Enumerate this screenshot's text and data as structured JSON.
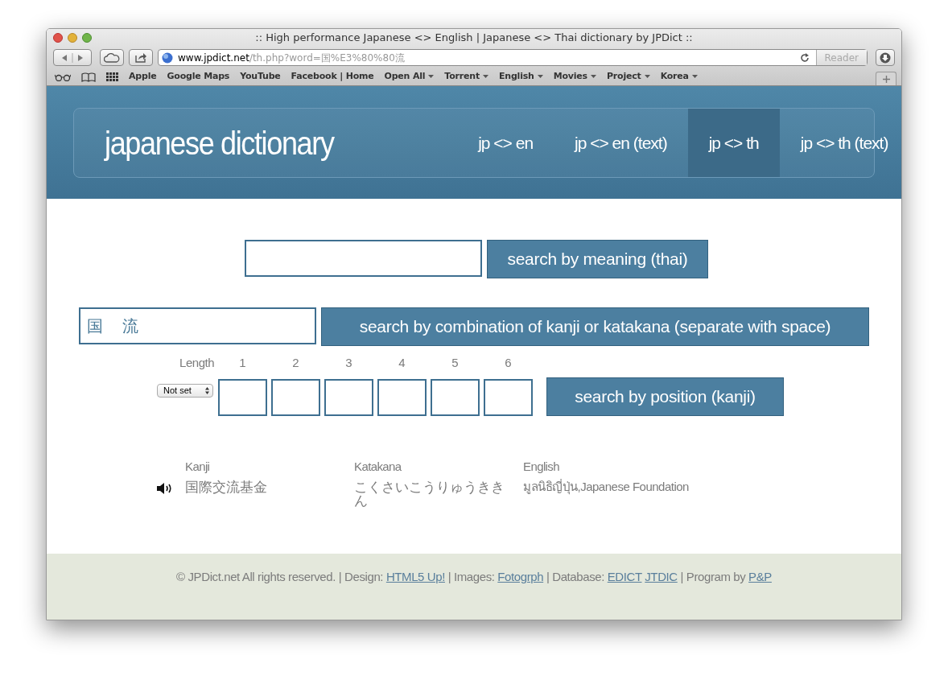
{
  "browser": {
    "title": ":: High performance Japanese <> English | Japanese <> Thai dictionary by JPDict ::",
    "url_host": "www.jpdict.net",
    "url_path": "/th.php?word=国%E3%80%80流",
    "reader": "Reader",
    "bookmarks": [
      {
        "label": "Apple",
        "menu": false
      },
      {
        "label": "Google Maps",
        "menu": false
      },
      {
        "label": "YouTube",
        "menu": false
      },
      {
        "label": "Facebook | Home",
        "menu": false
      },
      {
        "label": "Open All",
        "menu": true
      },
      {
        "label": "Torrent",
        "menu": true
      },
      {
        "label": "English",
        "menu": true
      },
      {
        "label": "Movies",
        "menu": true
      },
      {
        "label": "Project",
        "menu": true
      },
      {
        "label": "Korea",
        "menu": true
      }
    ]
  },
  "site": {
    "logo": "japanese dictionary",
    "nav": [
      {
        "label": "jp <> en",
        "selected": false
      },
      {
        "label": "jp <> en (text)",
        "selected": false
      },
      {
        "label": "jp <> th",
        "selected": true
      },
      {
        "label": "jp <> th (text)",
        "selected": false
      }
    ]
  },
  "meaning_search": {
    "button": "search by meaning (thai)"
  },
  "kanji_search": {
    "value": "国　流",
    "button": "search by combination of kanji or katakana (separate with space)"
  },
  "position_search": {
    "length_label": "Length",
    "length_select": "Not set",
    "positions": [
      "1",
      "2",
      "3",
      "4",
      "5",
      "6"
    ],
    "button": "search by position (kanji)"
  },
  "results": {
    "columns": [
      "Kanji",
      "Katakana",
      "English"
    ],
    "rows": [
      {
        "kanji": "国際交流基金",
        "katakana": "こくさいこうりゅうききん",
        "english": "มูลนิธิญี่ปุ่น,Japanese Foundation"
      }
    ]
  },
  "footer": [
    {
      "kind": "text",
      "text": "© JPDict.net All rights reserved. | Design: "
    },
    {
      "kind": "link",
      "text": "HTML5 Up!"
    },
    {
      "kind": "text",
      "text": " | Images: "
    },
    {
      "kind": "link",
      "text": "Fotogrph"
    },
    {
      "kind": "text",
      "text": " | Database: "
    },
    {
      "kind": "link",
      "text": "EDICT"
    },
    {
      "kind": "link",
      "text": "JTDIC"
    },
    {
      "kind": "text",
      "text": " | Program by "
    },
    {
      "kind": "link",
      "text": "P&P"
    }
  ]
}
